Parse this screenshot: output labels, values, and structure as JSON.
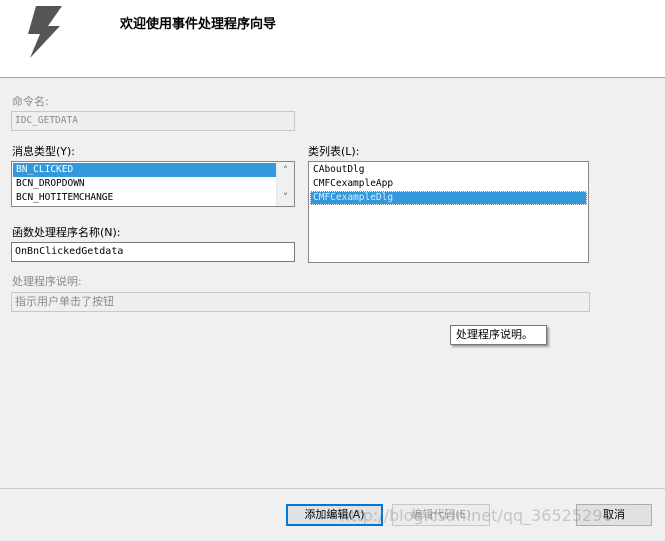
{
  "header": {
    "title": "欢迎使用事件处理程序向导",
    "icon": "lightning-bolt-icon"
  },
  "command": {
    "label": "命令名:",
    "value": "IDC_GETDATA"
  },
  "message_type": {
    "label": "消息类型(Y):",
    "items": [
      "BN_CLICKED",
      "BCN_DROPDOWN",
      "BCN_HOTITEMCHANGE"
    ],
    "selected": "BN_CLICKED"
  },
  "class_list": {
    "label": "类列表(L):",
    "items": [
      "CAboutDlg",
      "CMFCexampleApp",
      "CMFCexampleDlg"
    ],
    "selected": "CMFCexampleDlg"
  },
  "handler_name": {
    "label": "函数处理程序名称(N):",
    "value": "OnBnClickedGetdata"
  },
  "handler_desc": {
    "label": "处理程序说明:",
    "value": "指示用户单击了按钮"
  },
  "tooltip": {
    "text": "处理程序说明。"
  },
  "buttons": {
    "add_edit": "添加编辑(A)",
    "edit_code": "编辑代码(E)",
    "cancel": "取消"
  },
  "watermark": "http://blog.csdn.net/qq_36525296",
  "colors": {
    "selection": "#3399dd",
    "bolt": "#555555"
  }
}
